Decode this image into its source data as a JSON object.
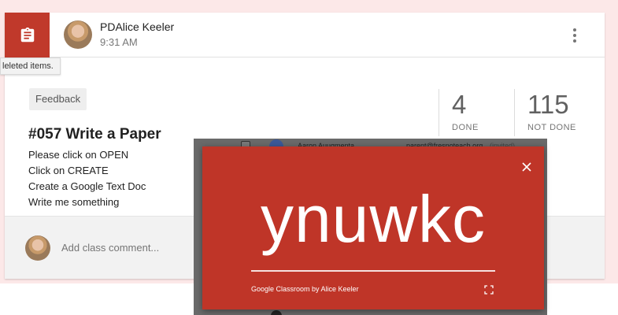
{
  "post": {
    "author_name": "PDAlice Keeler",
    "time": "9:31 AM",
    "topic": "Feedback",
    "title": "#057 Write a Paper",
    "instructions": [
      "Please click on OPEN",
      "Click on CREATE",
      "Create a Google Text Doc",
      "Write me something"
    ]
  },
  "tooltip": "leleted items.",
  "stats": {
    "done_count": "4",
    "done_label": "DONE",
    "not_done_count": "115",
    "not_done_label": "NOT DONE"
  },
  "comment": {
    "placeholder": "Add class comment..."
  },
  "roster": {
    "student_name": "Aaron Auugmenta",
    "student_email": "parent@fresnoteach.org",
    "student_status": "(invited)"
  },
  "code_dialog": {
    "class_code": "ynuwkc",
    "caption": "Google Classroom by Alice Keeler"
  },
  "colors": {
    "accent_red": "#c0392b",
    "backdrop_pink": "#fce8e8",
    "dialog_red": "#bf3528"
  },
  "icons": {
    "assignment": "assignment-clipboard-icon",
    "menu": "more-vert-icon",
    "close": "close-icon",
    "fullscreen": "fullscreen-icon"
  }
}
